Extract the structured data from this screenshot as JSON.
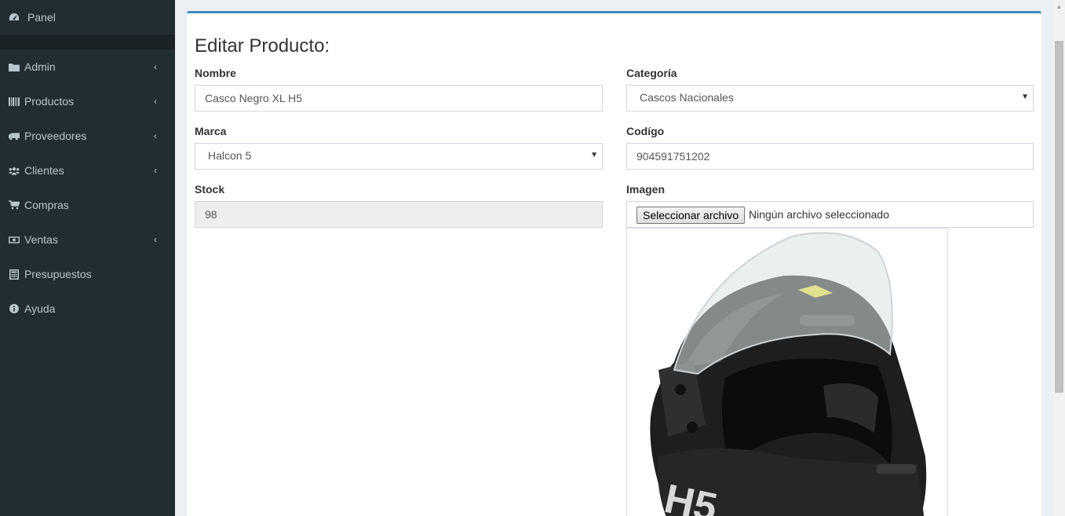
{
  "sidebar": {
    "items": [
      {
        "label": "Panel",
        "icon": "dashboard-icon",
        "has_submenu": false
      },
      {
        "label": "Admin",
        "icon": "folder-icon",
        "has_submenu": true
      },
      {
        "label": "Productos",
        "icon": "barcode-icon",
        "has_submenu": true
      },
      {
        "label": "Proveedores",
        "icon": "truck-icon",
        "has_submenu": true
      },
      {
        "label": "Clientes",
        "icon": "users-icon",
        "has_submenu": true
      },
      {
        "label": "Compras",
        "icon": "cart-icon",
        "has_submenu": false
      },
      {
        "label": "Ventas",
        "icon": "money-icon",
        "has_submenu": true
      },
      {
        "label": "Presupuestos",
        "icon": "calculator-icon",
        "has_submenu": false
      },
      {
        "label": "Ayuda",
        "icon": "info-icon",
        "has_submenu": false
      }
    ],
    "chevron": "‹"
  },
  "form": {
    "title": "Editar Producto:",
    "nombre": {
      "label": "Nombre",
      "value": "Casco Negro XL H5"
    },
    "categoria": {
      "label": "Categoría",
      "value": "Cascos Nacionales"
    },
    "marca": {
      "label": "Marca",
      "value": "Halcon 5"
    },
    "codigo": {
      "label": "Codígo",
      "value": "904591751202"
    },
    "stock": {
      "label": "Stock",
      "value": "98"
    },
    "imagen": {
      "label": "Imagen",
      "button": "Seleccionar archivo",
      "status": "Ningún archivo seleccionado"
    },
    "select_caret": "▼"
  },
  "colors": {
    "sidebar_bg": "#222d32",
    "sidebar_text": "#b8c7ce",
    "accent": "#3c8dbc",
    "content_bg": "#ecf0f5"
  }
}
